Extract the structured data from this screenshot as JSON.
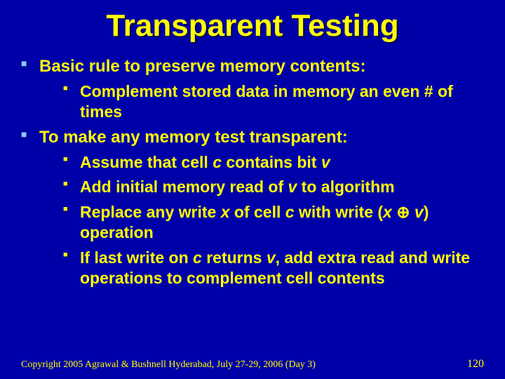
{
  "title": "Transparent Testing",
  "bullets": [
    {
      "text": "Basic rule to preserve memory contents:",
      "sub": [
        {
          "parts": [
            {
              "t": "Complement stored data in memory an even # of times"
            }
          ]
        }
      ]
    },
    {
      "text": "To make any memory test transparent:",
      "sub": [
        {
          "parts": [
            {
              "t": "Assume that cell "
            },
            {
              "t": "c",
              "ital": true
            },
            {
              "t": " contains bit "
            },
            {
              "t": "v",
              "ital": true
            }
          ]
        },
        {
          "parts": [
            {
              "t": "Add initial memory read of "
            },
            {
              "t": "v",
              "ital": true
            },
            {
              "t": " to algorithm"
            }
          ]
        },
        {
          "parts": [
            {
              "t": "Replace any write "
            },
            {
              "t": "x",
              "ital": true
            },
            {
              "t": " of cell "
            },
            {
              "t": "c",
              "ital": true
            },
            {
              "t": " with write ("
            },
            {
              "t": "x",
              "ital": true
            },
            {
              "t": " ",
              "nbsp": true
            },
            {
              "t": "⊕",
              "oplus": true
            },
            {
              "t": " ",
              "nbsp": true
            },
            {
              "t": "v",
              "ital": true
            },
            {
              "t": ") operation"
            }
          ]
        },
        {
          "parts": [
            {
              "t": "If last write on "
            },
            {
              "t": "c",
              "ital": true
            },
            {
              "t": " returns "
            },
            {
              "t": "v",
              "ital": true
            },
            {
              "t": ", add extra read and write operations to complement cell contents",
              "overbarTarget": "v"
            }
          ]
        }
      ]
    }
  ],
  "footer": "Copyright 2005 Agrawal & Bushnell   Hyderabad, July 27-29, 2006 (Day 3)",
  "pageNumber": "120"
}
